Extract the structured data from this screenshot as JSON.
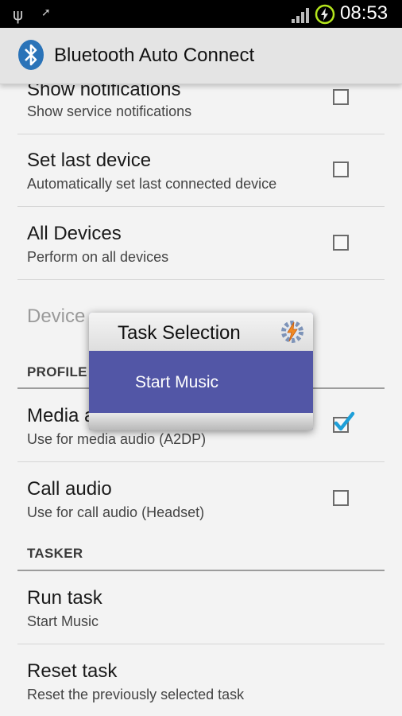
{
  "status_bar": {
    "time": "08:53",
    "icons": [
      "usb-icon",
      "flag-icon",
      "signal-icon",
      "battery-charging-icon"
    ]
  },
  "app_bar": {
    "title": "Bluetooth Auto Connect",
    "icon": "bluetooth-icon"
  },
  "preferences": {
    "show_notifications": {
      "title": "Show notifications",
      "summary": "Show service notifications",
      "checked": false
    },
    "set_last_device": {
      "title": "Set last device",
      "summary": "Automatically set last connected device",
      "checked": false
    },
    "all_devices": {
      "title": "All Devices",
      "summary": "Perform on all devices",
      "checked": false
    },
    "device": {
      "title": "Device",
      "enabled": false
    }
  },
  "profiles": {
    "header": "PROFILE",
    "media_audio": {
      "title": "Media audio",
      "summary": "Use for media audio (A2DP)",
      "checked": true
    },
    "call_audio": {
      "title": "Call audio",
      "summary": "Use for call audio (Headset)",
      "checked": false
    }
  },
  "tasker": {
    "header": "TASKER",
    "run_task": {
      "title": "Run task",
      "summary": "Start Music"
    },
    "reset_task": {
      "title": "Reset task",
      "summary": "Reset the previously selected task"
    }
  },
  "dialog": {
    "title": "Task Selection",
    "icon": "tasker-icon",
    "items": [
      "Start Music"
    ]
  },
  "colors": {
    "accent": "#33b5e5",
    "dialog_item_bg": "#5256a6",
    "check": "#1e9fd8"
  }
}
